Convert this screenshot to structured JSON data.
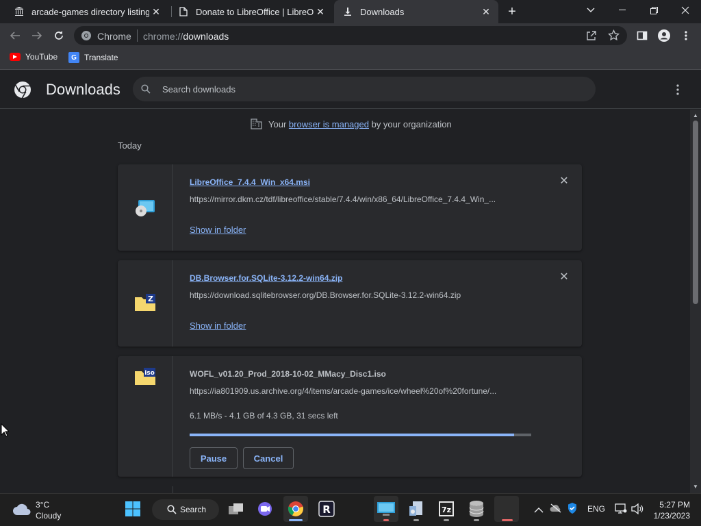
{
  "tabs": [
    {
      "title": "arcade-games directory listing",
      "icon": "archive-icon"
    },
    {
      "title": "Donate to LibreOffice | LibreOffic",
      "icon": "document-icon"
    },
    {
      "title": "Downloads",
      "icon": "download-icon",
      "active": true
    }
  ],
  "omnibox": {
    "site_label": "Chrome",
    "url_prefix": "chrome://",
    "url_path": "downloads"
  },
  "bookmarks": [
    {
      "label": "YouTube",
      "icon": "youtube-icon"
    },
    {
      "label": "Translate",
      "icon": "translate-icon"
    }
  ],
  "header": {
    "title": "Downloads",
    "search_placeholder": "Search downloads"
  },
  "managed": {
    "prefix": "Your",
    "link": "browser is managed",
    "suffix": "by your organization"
  },
  "section_label": "Today",
  "downloads": [
    {
      "filename": "LibreOffice_7.4.4_Win_x64.msi",
      "url": "https://mirror.dkm.cz/tdf/libreoffice/stable/7.4.4/win/x86_64/LibreOffice_7.4.4_Win_...",
      "action": "Show in folder",
      "icon": "installer-icon"
    },
    {
      "filename": "DB.Browser.for.SQLite-3.12.2-win64.zip",
      "url": "https://download.sqlitebrowser.org/DB.Browser.for.SQLite-3.12.2-win64.zip",
      "action": "Show in folder",
      "icon": "zip-folder-icon"
    },
    {
      "filename": "WOFL_v01.20_Prod_2018-10-02_MMacy_Disc1.iso",
      "url": "https://ia801909.us.archive.org/4/items/arcade-games/ice/wheel%20of%20fortune/...",
      "status": "6.1 MB/s - 4.1 GB of 4.3 GB, 31 secs left",
      "progress": 0.95,
      "pause_label": "Pause",
      "cancel_label": "Cancel",
      "icon": "iso-file-icon"
    }
  ],
  "taskbar": {
    "weather_temp": "3°C",
    "weather_desc": "Cloudy",
    "search_label": "Search",
    "language": "ENG",
    "time": "5:27 PM",
    "date": "1/23/2023"
  },
  "colors": {
    "accent": "#8ab4f8",
    "background": "#202124",
    "card": "#292a2d"
  }
}
